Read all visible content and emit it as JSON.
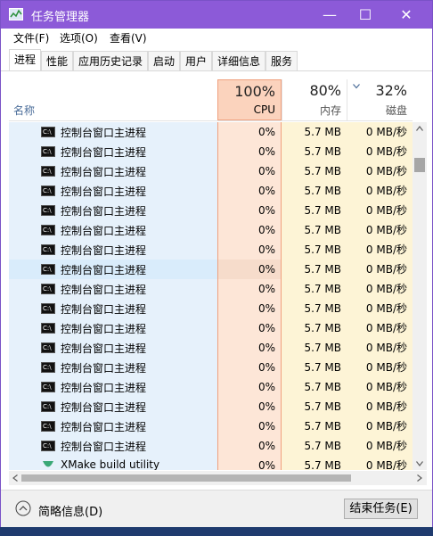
{
  "window": {
    "title": "任务管理器",
    "minimize": "—",
    "maximize": "☐",
    "close": "✕"
  },
  "menu": [
    "文件(F)",
    "选项(O)",
    "查看(V)"
  ],
  "tabs": [
    "进程",
    "性能",
    "应用历史记录",
    "启动",
    "用户",
    "详细信息",
    "服务"
  ],
  "header": {
    "name_label": "名称",
    "cpu": {
      "pct": "100%",
      "label": "CPU"
    },
    "mem": {
      "pct": "80%",
      "label": "内存"
    },
    "disk": {
      "pct": "32%",
      "label": "磁盘"
    }
  },
  "rows": [
    {
      "name": "控制台窗口主进程",
      "cpu": "0%",
      "mem": "5.7 MB",
      "disk": "0 MB/秒",
      "icon": "console-icon"
    },
    {
      "name": "控制台窗口主进程",
      "cpu": "0%",
      "mem": "5.7 MB",
      "disk": "0 MB/秒",
      "icon": "console-icon"
    },
    {
      "name": "控制台窗口主进程",
      "cpu": "0%",
      "mem": "5.7 MB",
      "disk": "0 MB/秒",
      "icon": "console-icon"
    },
    {
      "name": "控制台窗口主进程",
      "cpu": "0%",
      "mem": "5.7 MB",
      "disk": "0 MB/秒",
      "icon": "console-icon"
    },
    {
      "name": "控制台窗口主进程",
      "cpu": "0%",
      "mem": "5.7 MB",
      "disk": "0 MB/秒",
      "icon": "console-icon"
    },
    {
      "name": "控制台窗口主进程",
      "cpu": "0%",
      "mem": "5.7 MB",
      "disk": "0 MB/秒",
      "icon": "console-icon"
    },
    {
      "name": "控制台窗口主进程",
      "cpu": "0%",
      "mem": "5.7 MB",
      "disk": "0 MB/秒",
      "icon": "console-icon"
    },
    {
      "name": "控制台窗口主进程",
      "cpu": "0%",
      "mem": "5.7 MB",
      "disk": "0 MB/秒",
      "icon": "console-icon",
      "selected": true
    },
    {
      "name": "控制台窗口主进程",
      "cpu": "0%",
      "mem": "5.7 MB",
      "disk": "0 MB/秒",
      "icon": "console-icon"
    },
    {
      "name": "控制台窗口主进程",
      "cpu": "0%",
      "mem": "5.7 MB",
      "disk": "0 MB/秒",
      "icon": "console-icon"
    },
    {
      "name": "控制台窗口主进程",
      "cpu": "0%",
      "mem": "5.7 MB",
      "disk": "0 MB/秒",
      "icon": "console-icon"
    },
    {
      "name": "控制台窗口主进程",
      "cpu": "0%",
      "mem": "5.7 MB",
      "disk": "0 MB/秒",
      "icon": "console-icon"
    },
    {
      "name": "控制台窗口主进程",
      "cpu": "0%",
      "mem": "5.7 MB",
      "disk": "0 MB/秒",
      "icon": "console-icon"
    },
    {
      "name": "控制台窗口主进程",
      "cpu": "0%",
      "mem": "5.7 MB",
      "disk": "0 MB/秒",
      "icon": "console-icon"
    },
    {
      "name": "控制台窗口主进程",
      "cpu": "0%",
      "mem": "5.7 MB",
      "disk": "0 MB/秒",
      "icon": "console-icon"
    },
    {
      "name": "控制台窗口主进程",
      "cpu": "0%",
      "mem": "5.7 MB",
      "disk": "0 MB/秒",
      "icon": "console-icon"
    },
    {
      "name": "控制台窗口主进程",
      "cpu": "0%",
      "mem": "5.7 MB",
      "disk": "0 MB/秒",
      "icon": "console-icon"
    },
    {
      "name": "XMake build utility",
      "cpu": "0%",
      "mem": "5.7 MB",
      "disk": "0 MB/秒",
      "icon": "xmake-icon"
    }
  ],
  "console_icon_text": "C:\\",
  "footer": {
    "fewer_details": "简略信息(D)",
    "end_task": "结束任务(E)"
  },
  "colors": {
    "titlebar": "#8c5ad8",
    "cpu_header": "#fbd3bd",
    "cpu_cell": "#fde6d7",
    "mem_cell": "#fdf4d6"
  }
}
